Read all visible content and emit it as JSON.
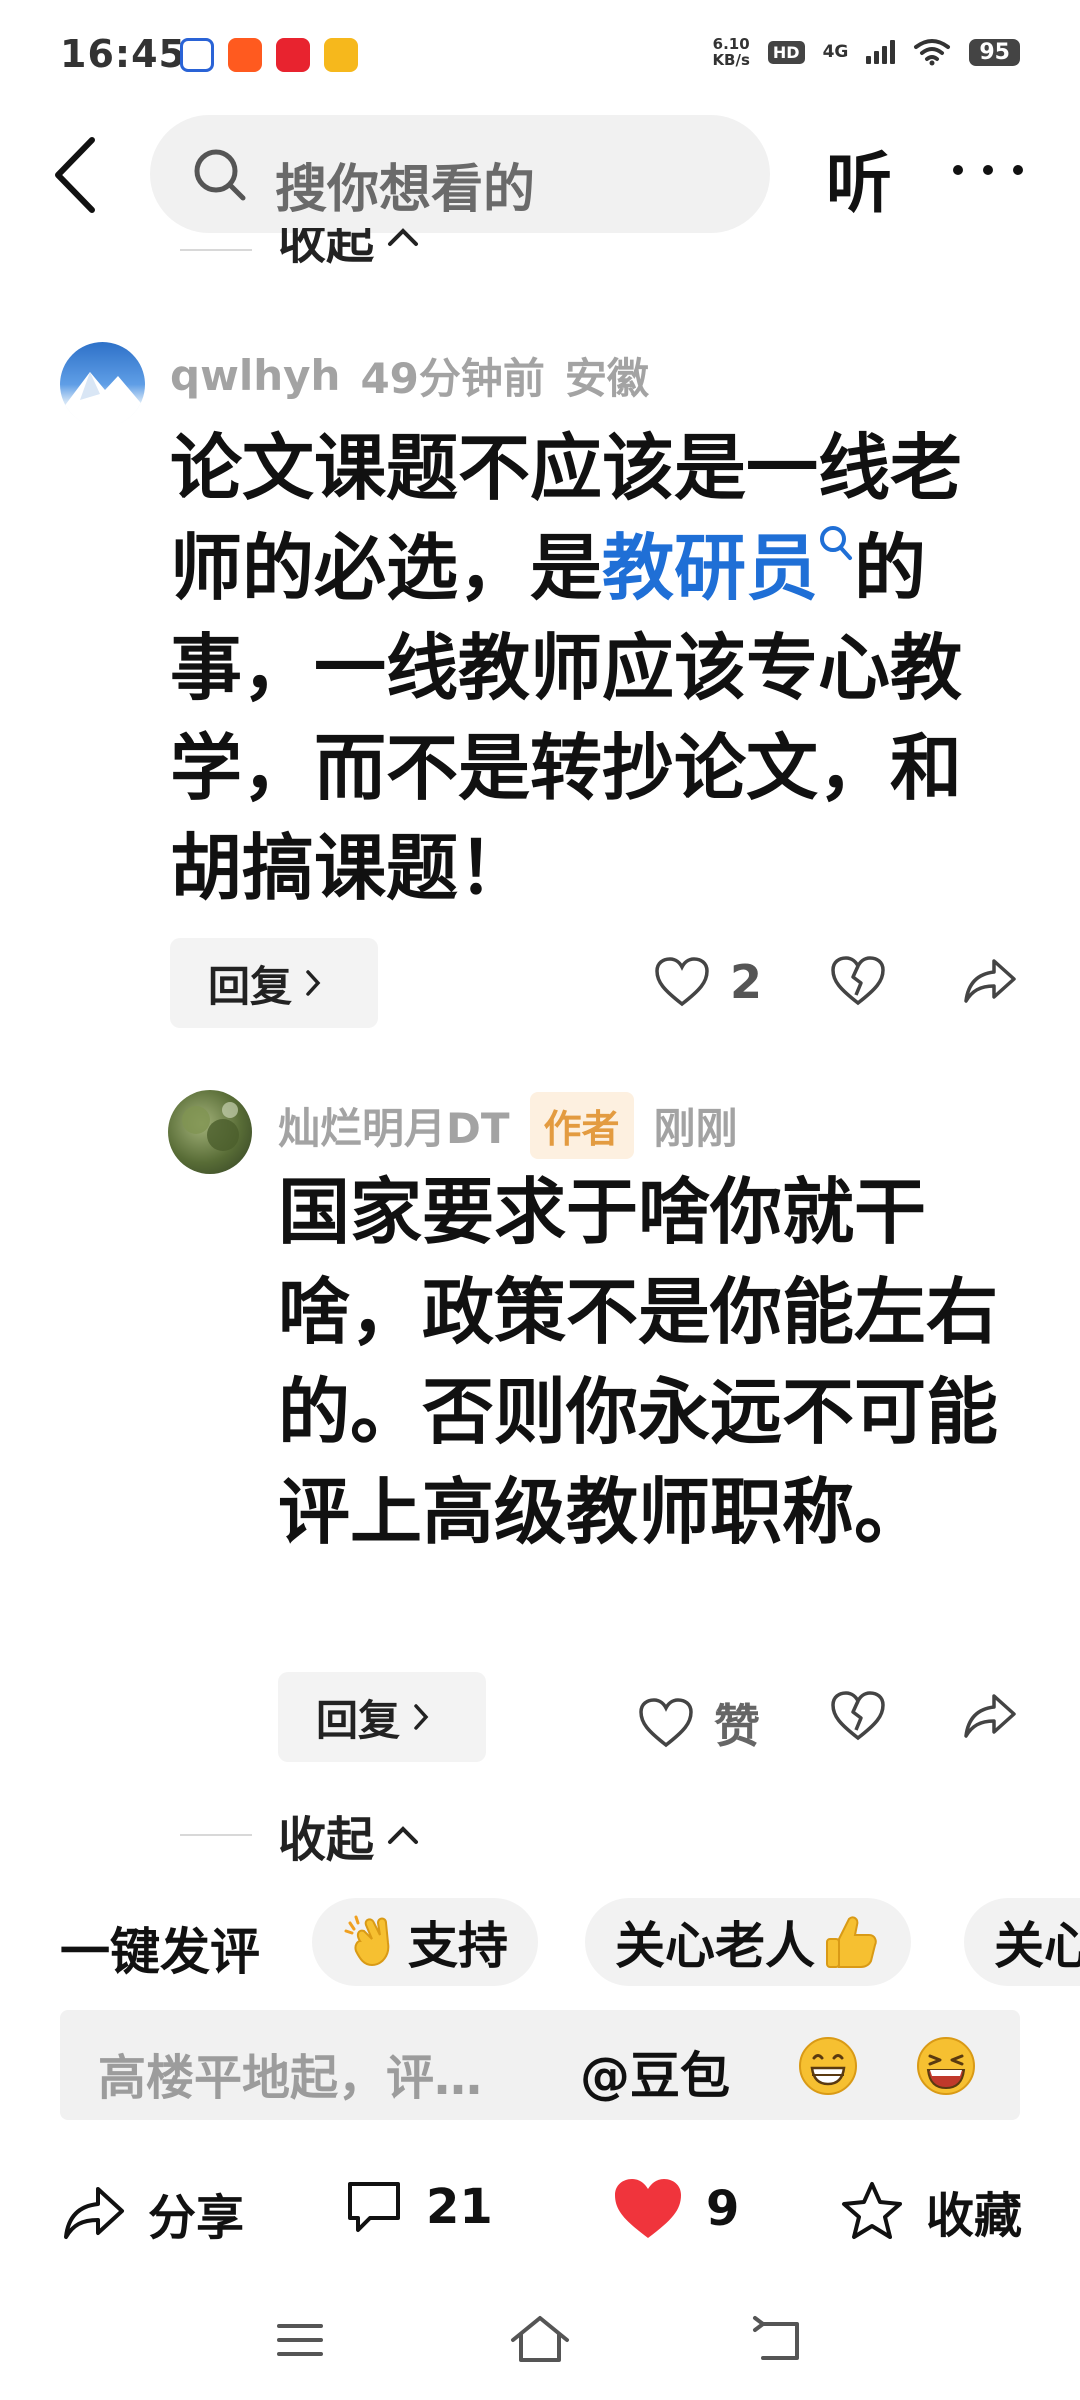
{
  "status": {
    "time": "16:45",
    "net_speed_value": "6.10",
    "net_speed_unit": "KB/s",
    "hd": "HD",
    "network": "4G",
    "battery": "95"
  },
  "topbar": {
    "search_placeholder": "搜你想看的",
    "listen_label": "听"
  },
  "collapse_label": "收起",
  "comments": [
    {
      "username": "qwlhyh",
      "time": "49分钟前",
      "location": "安徽",
      "text_before": "论文课题不应该是一线老师的必选，是",
      "keyword": "教研员",
      "text_after": "的事，一线教师应该专心教学，而不是转抄论文，和胡搞课题！",
      "reply_label": "回复",
      "like_count": "2"
    },
    {
      "username": "灿烂明月DT",
      "author_tag": "作者",
      "time": "刚刚",
      "text": "国家要求于啥你就干啥，政策不是你能左右的。否则你永远不可能评上高级教师职称。",
      "reply_label": "回复",
      "like_label": "赞"
    }
  ],
  "quick_replies": {
    "title": "一键发评",
    "chips": [
      "支持",
      "关心老人",
      "关心"
    ]
  },
  "comment_input": {
    "placeholder": "高楼平地起，评…",
    "ai_mention": "@豆包"
  },
  "bottom_bar": {
    "share_label": "分享",
    "comment_count": "21",
    "like_count": "9",
    "favorite_label": "收藏"
  },
  "colors": {
    "link_blue": "#1f6fd6",
    "heart_red": "#f0343c",
    "author_tag_bg": "#fdf0e0",
    "author_tag_text": "#e39b40"
  }
}
